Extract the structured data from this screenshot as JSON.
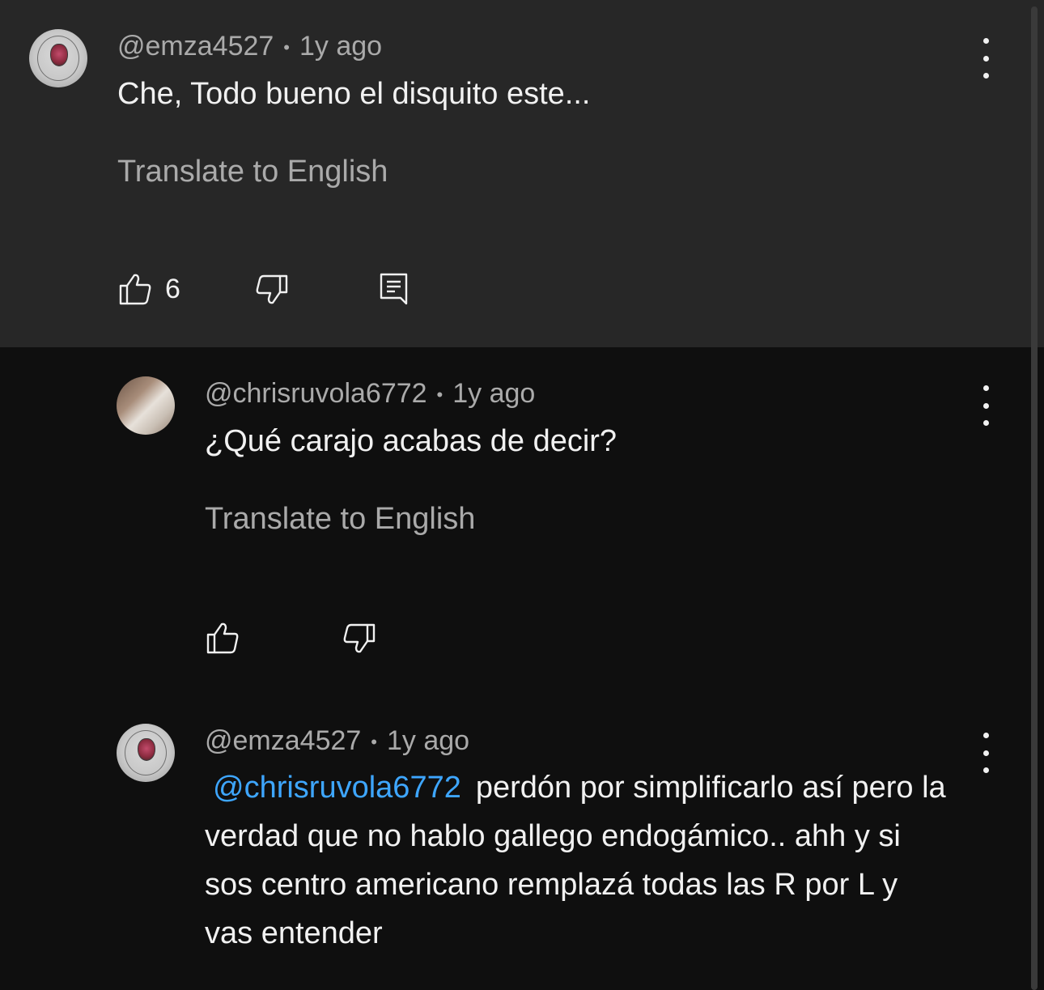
{
  "comments": [
    {
      "author": "@emza4527",
      "separator": "•",
      "time": "1y ago",
      "text": "Che, Todo bueno el disquito este...",
      "translate": "Translate to English",
      "likes": "6"
    },
    {
      "author": "@chrisruvola6772",
      "separator": "•",
      "time": "1y ago",
      "text": "¿Qué carajo acabas de decir?",
      "translate": "Translate to English"
    },
    {
      "author": "@emza4527",
      "separator": "•",
      "time": "1y ago",
      "mention": "@chrisruvola6772",
      "text": "perdón por simplificarlo así pero la verdad que no hablo gallego endogámico.. ahh y si sos centro americano remplazá todas las R por L y vas entender"
    }
  ],
  "icons": {
    "like": "thumbs-up-icon",
    "dislike": "thumbs-down-icon",
    "reply": "reply-comment-icon",
    "more": "more-vertical-icon"
  }
}
